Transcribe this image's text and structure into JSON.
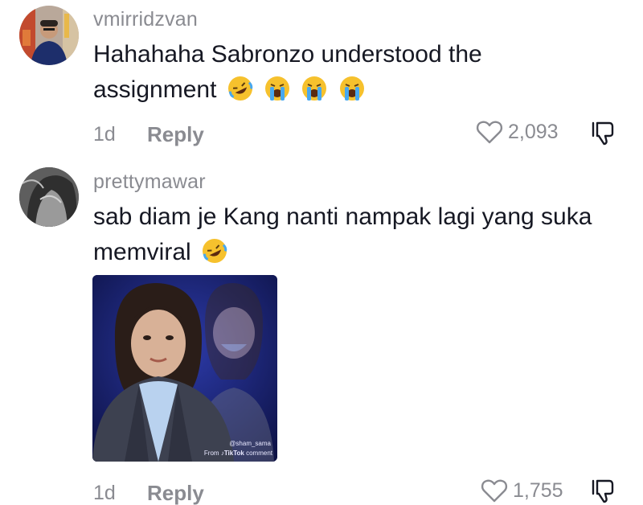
{
  "comments": [
    {
      "username": "vmirridzvan",
      "text_line1": "Hahahaha Sabronzo understood the",
      "text_line2": "assignment",
      "emojis": [
        "rofl-emoji",
        "crying-emoji",
        "crying-emoji",
        "crying-emoji"
      ],
      "time": "1d",
      "reply_label": "Reply",
      "likes": "2,093"
    },
    {
      "username": "prettymawar",
      "text_line1": "sab diam je Kang nanti nampak lagi yang suka",
      "text_line2": "memviral",
      "emojis": [
        "rofl-emoji"
      ],
      "time": "1d",
      "reply_label": "Reply",
      "likes": "1,755",
      "attachment": {
        "watermark_user": "@sham_sama",
        "watermark_source_prefix": "From",
        "watermark_brand": "TikTok",
        "watermark_suffix": "comment"
      }
    }
  ]
}
